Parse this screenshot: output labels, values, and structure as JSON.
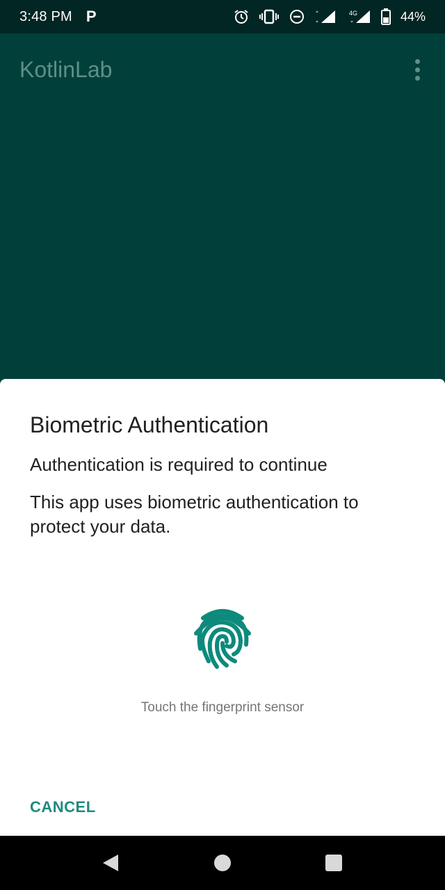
{
  "status_bar": {
    "time": "3:48 PM",
    "notification_icon": "P",
    "network": "4G",
    "battery": "44%"
  },
  "app_bar": {
    "title": "KotlinLab"
  },
  "dialog": {
    "title": "Biometric Authentication",
    "subtitle": "Authentication is required to continue",
    "description": "This app uses biometric authentication to protect your data.",
    "hint": "Touch the fingerprint sensor",
    "cancel_label": "CANCEL"
  },
  "colors": {
    "primary_dark": "#012623",
    "primary": "#003f3a",
    "accent": "#1f8a7f",
    "fingerprint": "#0e8a7c"
  },
  "icons": {
    "status": [
      "alarm-icon",
      "vibrate-icon",
      "do-not-disturb-icon",
      "wifi-signal-icon",
      "cell-signal-icon",
      "battery-icon"
    ],
    "app_bar": [
      "more-vert-icon"
    ],
    "dialog": [
      "fingerprint-icon"
    ],
    "nav": [
      "back-icon",
      "home-icon",
      "recents-icon"
    ]
  }
}
